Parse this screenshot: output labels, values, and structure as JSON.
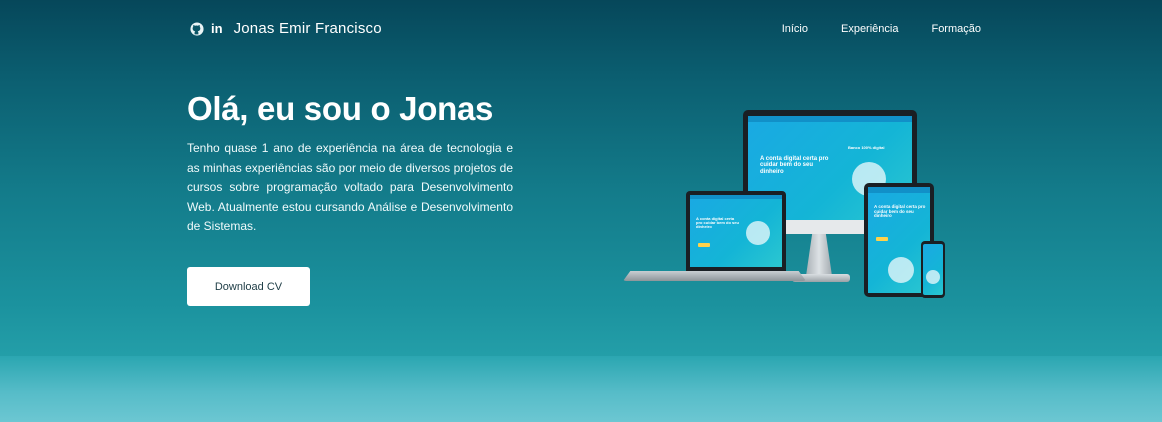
{
  "header": {
    "brand_name": "Jonas Emir Francisco",
    "linkedin_label": "in",
    "icons": [
      "github-icon",
      "linkedin-icon"
    ],
    "nav": [
      {
        "label": "Início"
      },
      {
        "label": "Experiência"
      },
      {
        "label": "Formação"
      }
    ]
  },
  "hero": {
    "title": "Olá, eu sou o Jonas",
    "description": "Tenho quase 1 ano de experiência na área de tecnologia e as minhas experiências são por meio de diversos projetos de cursos sobre programação voltado para Desenvolvimento Web. Atualmente estou cursando Análise e Desenvolvimento de Sistemas.",
    "button_label": "Download CV"
  },
  "illustration": {
    "monitor_headline": "A conta digital certa pro cuidar bem do seu dinheiro",
    "laptop_headline": "A conta digital certa pro cuidar bem do seu dinheiro",
    "tablet_headline": "A conta digital certa pro cuidar bem do seu dinheiro",
    "badge_text": "Banco 100% digital"
  },
  "colors": {
    "background_top": "#06475a",
    "background_bottom": "#6cc7d2",
    "button_bg": "#ffffff",
    "button_text": "#1d3c45",
    "screen_accent": "#1aa9e3"
  }
}
